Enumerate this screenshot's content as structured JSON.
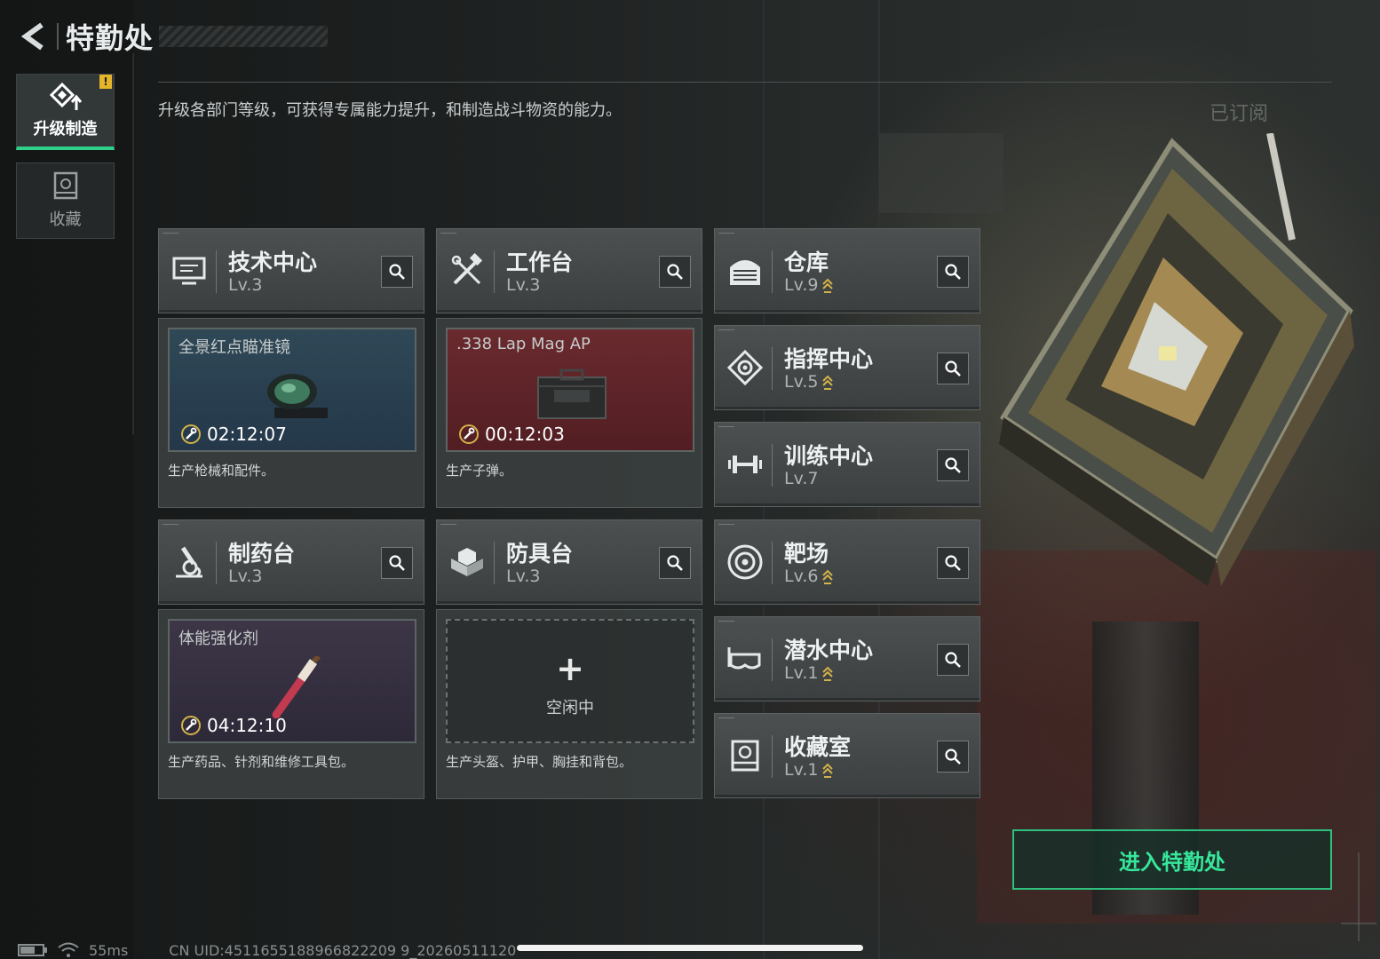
{
  "header": {
    "title": "特勤处"
  },
  "sidebar": {
    "tabs": [
      {
        "label": "升级制造",
        "active": true,
        "alert": "!"
      },
      {
        "label": "收藏",
        "active": false
      }
    ]
  },
  "description": "升级各部门等级，可获得专属能力提升，和制造战斗物资的能力。",
  "subscribed_label": "已订阅",
  "facilities": {
    "tech_center": {
      "name": "技术中心",
      "level": "Lv.3",
      "icon": "monitor-icon"
    },
    "workbench": {
      "name": "工作台",
      "level": "Lv.3",
      "icon": "hammer-wrench-icon"
    },
    "warehouse": {
      "name": "仓库",
      "level": "Lv.9",
      "icon": "warehouse-icon",
      "upgradable": true
    },
    "command_center": {
      "name": "指挥中心",
      "level": "Lv.5",
      "icon": "command-gear-icon",
      "upgradable": true
    },
    "training_center": {
      "name": "训练中心",
      "level": "Lv.7",
      "icon": "dumbbell-icon"
    },
    "pharmacy": {
      "name": "制药台",
      "level": "Lv.3",
      "icon": "microscope-icon"
    },
    "armor_bench": {
      "name": "防具台",
      "level": "Lv.3",
      "icon": "cubes-icon"
    },
    "range": {
      "name": "靶场",
      "level": "Lv.6",
      "icon": "target-icon",
      "upgradable": true
    },
    "diving_center": {
      "name": "潜水中心",
      "level": "Lv.1",
      "icon": "diving-mask-icon",
      "upgradable": true
    },
    "collection_room": {
      "name": "收藏室",
      "level": "Lv.1",
      "icon": "collection-icon",
      "upgradable": true
    }
  },
  "production": {
    "tech_center": {
      "item": "全景红点瞄准镜",
      "timer": "02:12:07",
      "desc": "生产枪械和配件。",
      "color": "#2f4856"
    },
    "workbench": {
      "item": ".338 Lap Mag AP",
      "timer": "00:12:03",
      "desc": "生产子弹。",
      "color": "#6a2a2e"
    },
    "pharmacy": {
      "item": "体能强化剂",
      "timer": "04:12:10",
      "desc": "生产药品、针剂和维修工具包。",
      "color": "#3c3646"
    },
    "armor_bench": {
      "plus": "+",
      "status": "空闲中",
      "desc": "生产头盔、护甲、胸挂和背包。"
    }
  },
  "enter_button": "进入特勤处",
  "status_bar": {
    "ping": "55ms",
    "uid": "CN UID:4511655188966822209 9_20260511120"
  },
  "colors": {
    "accent": "#2fd08a",
    "upgrade": "#d4b24a",
    "alert": "#e4b429"
  }
}
